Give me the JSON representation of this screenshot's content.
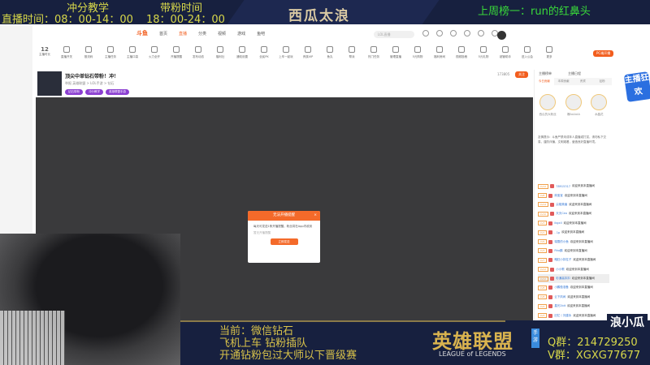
{
  "overlay": {
    "teaching": "冲分教学",
    "fans_time": "带粉时间",
    "live_time": "直播时间：08：00-14：00",
    "fans_hours": "18：00-24：00",
    "brand": "西瓜太浪",
    "rank": "上周榜一：run的红鼻头",
    "bottom_lines": [
      "当前：微信钻石",
      "飞机上车 钻粉插队",
      "开通钻粉包过大师以下晋级赛"
    ],
    "game": "英雄联盟",
    "game_sub": "LEAGUE of LEGENDS",
    "game_mobile": "手游",
    "weibo": "浪小瓜",
    "qq": "Q群：214729250",
    "vx": "V群：XGXG77677"
  },
  "nav": {
    "logo": "斗鱼",
    "items": [
      "首页",
      "直播",
      "分类",
      "视频",
      "游戏",
      "鱼吧"
    ],
    "search_placeholder": "LOL直播"
  },
  "toolbar": {
    "level": "12",
    "items": [
      "主播时长",
      "直播开关",
      "推流码",
      "主播任务",
      "主播口袋",
      "火力全开",
      "开播提醒",
      "发布动态",
      "福利社",
      "通知设置",
      "全民PK",
      "上车一起玩",
      "贵族VIP",
      "鱼丸",
      "帮派",
      "热门任务",
      "管理直播",
      "5元购物",
      "福利房间",
      "视频投稿",
      "5元礼物",
      "超管助手",
      "进入公会",
      "更多"
    ],
    "pc_button": "PC端开播",
    "pc_sub": "主播端PC入口"
  },
  "room": {
    "title": "顶尖中单钻石带粉！冲！",
    "meta": "举报  英雄联盟 > LOL手游 > 钻石",
    "fans": "173805",
    "follow": "关注",
    "tags": [
      "钻石带粉",
      "冲分教学",
      "英雄联盟手游"
    ]
  },
  "modal": {
    "title": "无法开播提醒",
    "body": "每天可发送1条开播提醒，粉丝将在App内收到",
    "hint": "暂无开播提醒",
    "button": "立即发送"
  },
  "panel": {
    "top": [
      "主播榜单",
      "主播日程"
    ],
    "tabs": [
      "今日贡献",
      "本周贡献",
      "贵宾",
      "钻粉"
    ],
    "ranks": [
      "西瓜的大粉丝",
      "爆AAAAA",
      "水晶花"
    ],
    "notice": "友情提示：斗鱼严禁未成年人直播或打赏，请勿私下交易，谨防诈骗，文明观看，营造良好直播环境。",
    "chat": [
      {
        "lv": "LV12",
        "user": "78915317",
        "text": "欢迎来到本直播间"
      },
      {
        "lv": "LV8",
        "user": "熊宝宝",
        "text": "欢迎来到本直播间"
      },
      {
        "lv": "LV14",
        "user": "尖椒美眉",
        "text": "欢迎来到本直播间"
      },
      {
        "lv": "LV10",
        "user": "天天Ceo",
        "text": "欢迎来到本直播间"
      },
      {
        "lv": "LV3",
        "user": "ikgxll",
        "text": "欢迎来到本直播间"
      },
      {
        "lv": "LV1",
        "user": "- 1p",
        "text": "欢迎来到本直播间"
      },
      {
        "lv": "LV9",
        "user": "瑞雪的小鱼",
        "text": "欢迎来到本直播间"
      },
      {
        "lv": "LV3",
        "user": "Rho鹏",
        "text": "欢迎来到本直播间"
      },
      {
        "lv": "LV7",
        "user": "略狂小扣柱子",
        "text": "欢迎来到本直播间"
      },
      {
        "lv": "LV12",
        "user": "小小歌",
        "text": "欢迎来到本直播间"
      },
      {
        "lv": "LV12",
        "user": "彩通高扣扣",
        "text": "欢迎来到本直播间"
      },
      {
        "lv": "LV8",
        "user": "小鹏做准备",
        "text": "欢迎来到本直播间"
      },
      {
        "lv": "LV8",
        "user": "云下风间",
        "text": "欢迎来到本直播间"
      },
      {
        "lv": "LV4",
        "user": "星光2bit",
        "text": "欢迎来到本直播间"
      },
      {
        "lv": "LV3",
        "user": "旧忆丨刘建永",
        "text": "欢迎来到本直播间"
      },
      {
        "lv": "LV8",
        "user": "且八倍啊啊啊",
        "text": "欢迎来到本直播间"
      }
    ]
  },
  "badge": "主播狂欢"
}
